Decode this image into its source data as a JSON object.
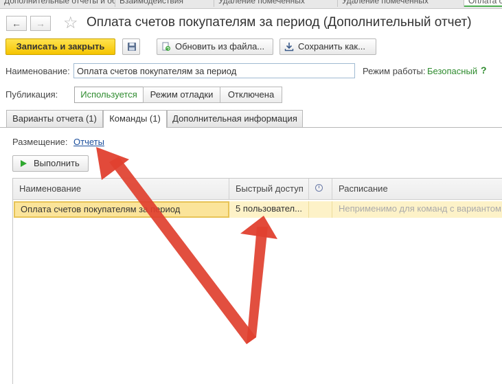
{
  "top_tabs": [
    {
      "label": "Дополнительные отчеты и обработки"
    },
    {
      "label": "Взаимодействия"
    },
    {
      "label": "Удаление помеченных"
    },
    {
      "label": "Удаление помеченных"
    },
    {
      "label": "Оплата счетов"
    }
  ],
  "header": {
    "back_icon": "←",
    "forward_icon": "→",
    "star_icon": "☆",
    "title": "Оплата счетов покупателям за период (Дополнительный отчет)"
  },
  "toolbar": {
    "save_close_label": "Записать и закрыть",
    "update_label": "Обновить из файла...",
    "save_as_label": "Сохранить как..."
  },
  "form": {
    "name_label": "Наименование:",
    "name_value": "Оплата счетов покупателям за период",
    "mode_label": "Режим работы:",
    "mode_value": "Безопасный",
    "help": "?",
    "publication_label": "Публикация:",
    "publication_options": [
      "Используется",
      "Режим отладки",
      "Отключена"
    ],
    "publication_selected": "Используется"
  },
  "tabs": [
    {
      "label": "Варианты отчета (1)"
    },
    {
      "label": "Команды (1)"
    },
    {
      "label": "Дополнительная информация"
    }
  ],
  "active_tab": "Команды (1)",
  "commands": {
    "placement_label": "Размещение:",
    "placement_link": "Отчеты",
    "run_label": "Выполнить",
    "columns": [
      "Наименование",
      "Быстрый доступ",
      "clock-icon",
      "Расписание"
    ],
    "rows": [
      {
        "name": "Оплата счетов покупателям за период",
        "quick_access": "5 пользовател...",
        "schedule": "Неприменимо для команд с вариантом"
      }
    ]
  },
  "colors": {
    "accent_yellow": "#f5c400",
    "green_text": "#2e8b2e",
    "link_blue": "#1a4e9c",
    "selection": "#fbe49a",
    "arrow_red": "#e0402f"
  }
}
